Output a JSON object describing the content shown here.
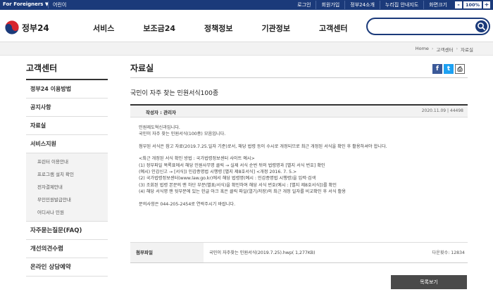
{
  "topbar": {
    "foreigners": "For Foreigners ▼",
    "kids": "어린이",
    "links": [
      "로그인",
      "회원가입",
      "정부24소개",
      "누리집 안내지도",
      "화면크기"
    ],
    "zoom_minus": "-",
    "zoom_value": "100%",
    "zoom_plus": "+"
  },
  "header": {
    "logo_text": "정부24",
    "menus": [
      "서비스",
      "보조금24",
      "정책정보",
      "기관정보",
      "고객센터"
    ],
    "search_value": ""
  },
  "breadcrumb": [
    "Home",
    "고객센터",
    "자료실"
  ],
  "lnb": {
    "title": "고객센터",
    "items": [
      "정부24 이용방법",
      "공지사항",
      "자료실",
      "서비스지원"
    ],
    "subitems": [
      "프린터 이용안내",
      "프로그램 설치 확인",
      "전자결제안내",
      "무인민원발급안내",
      "어디서나 민원"
    ],
    "items2": [
      "자주묻는질문(FAQ)",
      "개선의견수렴",
      "온라인 상담예약"
    ]
  },
  "content": {
    "page_title": "자료실",
    "share": {
      "facebook": "f",
      "twitter": "t",
      "print": "⎙"
    },
    "post_title": "국민이 자주 찾는 민원서식100종",
    "author": "작성자 : 관리자",
    "date": "2020.11.09 | 44498",
    "body": [
      "민원제도혁신과입니다.",
      "국민이 자주 찾는 민원서식(100종) 모음입니다.",
      "",
      "첨부된 서식은 참고 자료(2019.7.25.일자 기준)로서, 해당 법령 등이 수시로 개정되므로 최근 개정된 서식을 확인 후 활용하셔야 합니다.",
      "",
      "<최근 개정된 서식 확인 방법 : 국가법령정보센터 사이트 예시>",
      "(1) 정부파일 목록표에서 해당 민원사무명 클릭 → 실제 서식 순번 뒤의 법령명과 [별지 서식 번호] 확인",
      "(예시) 인감신고 → [서식]) 인감증명법 시행령 [별지 제8호서식] <개정 2016. 7. 5.>",
      "(2) 국가법령정보센터(www.law.go.kr)에서 해당 법령명(예시 : 인감증명법 시행령)을 입력·검색",
      "(3) 조회된 법령 본문의 맨 하단 부분(별표/서식)을 확인하여 해당 서식 번호(예시 : [별지 제8호서식])를 확인",
      "(4) 해당 서식명 맨 뒷부분에 있는 한글 아크 혹은 클릭 파일(열기/저장)의 최근 개정 일자를 비교확인 후 서식 활용",
      "",
      "문의사항은 044-205-2454로 연락주시기 바랍니다."
    ],
    "attach_label": "첨부파일",
    "attach_file": "국민이 자주찾는 민원서식(2019.7.25).hwp( 1,277KB)",
    "download_count": "다운횟수: 12834",
    "list_button": "목록보기"
  }
}
